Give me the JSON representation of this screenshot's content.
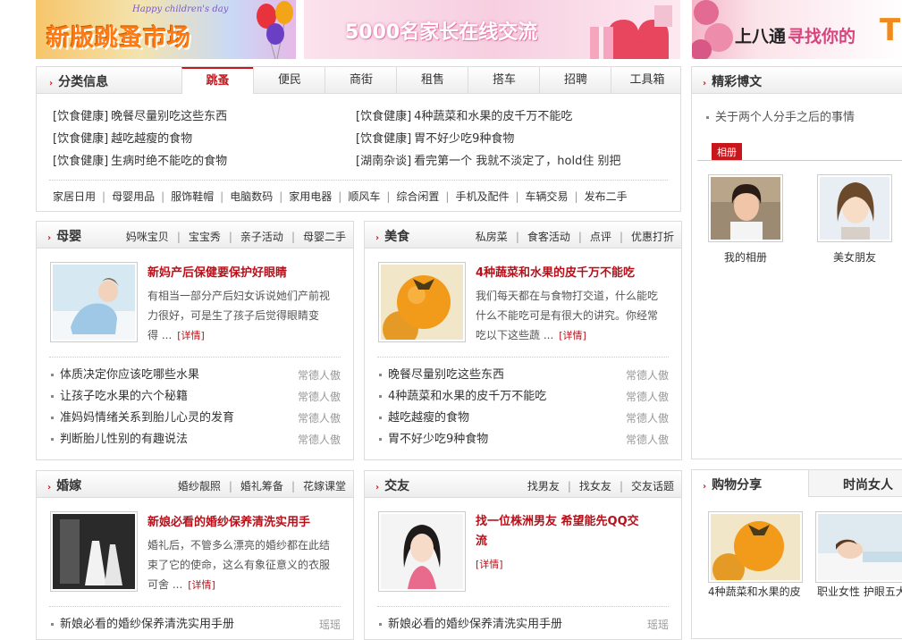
{
  "banners": {
    "b1_caption": "Happy children's day",
    "b1_title": "新版跳蚤市场",
    "b2_title": "5000名家长在线交流",
    "b3_title_a": "上八通",
    "b3_title_b": "寻找你的"
  },
  "classify": {
    "title": "分类信息",
    "tabs": [
      "跳蚤",
      "便民",
      "商街",
      "租售",
      "搭车",
      "招聘",
      "工具箱"
    ],
    "left_items": [
      {
        "tag": "[饮食健康]",
        "text": "晚餐尽量别吃这些东西"
      },
      {
        "tag": "[饮食健康]",
        "text": "越吃越瘦的食物"
      },
      {
        "tag": "[饮食健康]",
        "text": "生病时绝不能吃的食物"
      }
    ],
    "right_items": [
      {
        "tag": "[饮食健康]",
        "text": "4种蔬菜和水果的皮千万不能吃"
      },
      {
        "tag": "[饮食健康]",
        "text": "胃不好少吃9种食物"
      },
      {
        "tag": "[湖南杂谈]",
        "text": "看完第一个 我就不淡定了，hold住 别把"
      }
    ],
    "categories": [
      "家居日用",
      "母婴用品",
      "服饰鞋帽",
      "电脑数码",
      "家用电器",
      "顺风车",
      "综合闲置",
      "手机及配件",
      "车辆交易",
      "发布二手"
    ]
  },
  "blog": {
    "title": "精彩博文",
    "item": "关于两个人分手之后的事情",
    "album_tag": "相册",
    "albums": [
      "我的相册",
      "美女朋友"
    ]
  },
  "muying": {
    "title": "母婴",
    "links": [
      "妈咪宝贝",
      "宝宝秀",
      "亲子活动",
      "母婴二手"
    ],
    "feature_title": "新妈产后保健要保护好眼睛",
    "feature_lines": [
      "有相当一部分产后妇女诉说她们产前视",
      "力很好，可是生了孩子后觉得眼睛变",
      "得 ..."
    ],
    "more": "[详情]",
    "list": [
      {
        "text": "体质决定你应该吃哪些水果",
        "src": "常德人傲"
      },
      {
        "text": "让孩子吃水果的六个秘籍",
        "src": "常德人傲"
      },
      {
        "text": "准妈妈情绪关系到胎儿心灵的发育",
        "src": "常德人傲"
      },
      {
        "text": "判断胎儿性别的有趣说法",
        "src": "常德人傲"
      }
    ]
  },
  "meishi": {
    "title": "美食",
    "links": [
      "私房菜",
      "食客活动",
      "点评",
      "优惠打折"
    ],
    "feature_title": "4种蔬菜和水果的皮千万不能吃",
    "feature_lines": [
      "我们每天都在与食物打交道，什么能吃",
      "什么不能吃可是有很大的讲究。你经常",
      "吃以下这些蔬 ..."
    ],
    "more": "[详情]",
    "list": [
      {
        "text": "晚餐尽量别吃这些东西",
        "src": "常德人傲"
      },
      {
        "text": "4种蔬菜和水果的皮千万不能吃",
        "src": "常德人傲"
      },
      {
        "text": "越吃越瘦的食物",
        "src": "常德人傲"
      },
      {
        "text": "胃不好少吃9种食物",
        "src": "常德人傲"
      }
    ]
  },
  "hunjia": {
    "title": "婚嫁",
    "links": [
      "婚纱靓照",
      "婚礼筹备",
      "花嫁课堂"
    ],
    "feature_title": "新娘必看的婚纱保养清洗实用手",
    "feature_lines": [
      "婚礼后，不管多么漂亮的婚纱都在此结",
      "束了它的使命，这么有象征意义的衣服",
      "可舍 ..."
    ],
    "more": "[详情]",
    "list": [
      {
        "text": "新娘必看的婚纱保养清洗实用手册",
        "src": "瑶瑶"
      }
    ]
  },
  "jiaoyou": {
    "title": "交友",
    "links": [
      "找男友",
      "找女友",
      "交友话题"
    ],
    "feature_title_lines": [
      "找一位株洲男友 希望能先QQ交",
      "流"
    ],
    "more": "[详情]",
    "list": [
      {
        "text": "新娘必看的婚纱保养清洗实用手册",
        "src": "瑶瑶"
      }
    ]
  },
  "shop": {
    "tabs": [
      "购物分享",
      "时尚女人"
    ],
    "items": [
      "4种蔬菜和水果的皮",
      "职业女性 护眼五大"
    ]
  }
}
